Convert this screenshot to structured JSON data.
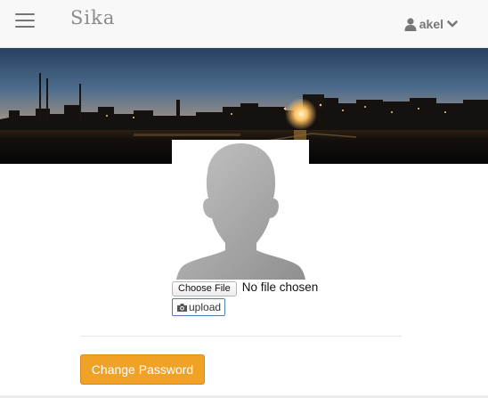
{
  "navbar": {
    "brand": "Sika",
    "menu_icon": "hamburger-icon",
    "user": {
      "name": "akel",
      "icon": "user-icon",
      "dropdown_icon": "chevron-down-icon"
    }
  },
  "banner": {
    "description_icon": "city-skyline-sunset-image"
  },
  "profile": {
    "avatar_icon": "default-avatar-silhouette",
    "file_input": {
      "button_label": "Choose File",
      "status": "No file chosen"
    },
    "upload": {
      "icon": "camera-icon",
      "label": "upload"
    }
  },
  "actions": {
    "change_password_label": "Change Password"
  },
  "colors": {
    "navbar_bg": "#f8f8f8",
    "accent_orange": "#f0a226",
    "upload_border": "#4f7fad"
  }
}
